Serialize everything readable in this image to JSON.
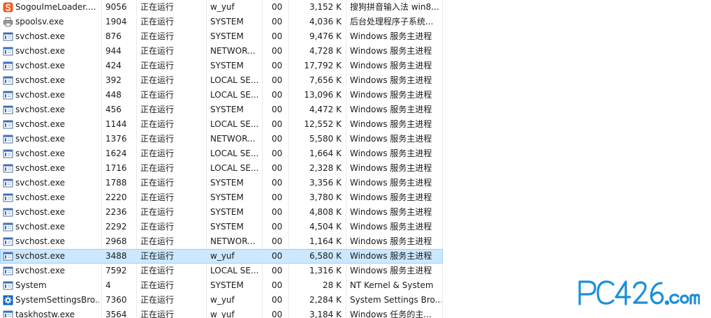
{
  "rows": [
    {
      "name": "SogouImeLoader....",
      "pid": "9056",
      "status": "正在运行",
      "user": "w_yuf",
      "cpu": "00",
      "mem": "3,152 K",
      "desc": "搜狗拼音输入法 win8...",
      "icon": "sogou-ime-icon",
      "selected": false
    },
    {
      "name": "spoolsv.exe",
      "pid": "1904",
      "status": "正在运行",
      "user": "SYSTEM",
      "cpu": "00",
      "mem": "4,036 K",
      "desc": "后台处理程序子系统...",
      "icon": "printer-icon",
      "selected": false
    },
    {
      "name": "svchost.exe",
      "pid": "876",
      "status": "正在运行",
      "user": "SYSTEM",
      "cpu": "00",
      "mem": "9,476 K",
      "desc": "Windows 服务主进程",
      "icon": "service-window-icon",
      "selected": false
    },
    {
      "name": "svchost.exe",
      "pid": "944",
      "status": "正在运行",
      "user": "NETWOR...",
      "cpu": "00",
      "mem": "4,728 K",
      "desc": "Windows 服务主进程",
      "icon": "service-window-icon",
      "selected": false
    },
    {
      "name": "svchost.exe",
      "pid": "424",
      "status": "正在运行",
      "user": "SYSTEM",
      "cpu": "00",
      "mem": "17,792 K",
      "desc": "Windows 服务主进程",
      "icon": "service-window-icon",
      "selected": false
    },
    {
      "name": "svchost.exe",
      "pid": "392",
      "status": "正在运行",
      "user": "LOCAL SE...",
      "cpu": "00",
      "mem": "7,656 K",
      "desc": "Windows 服务主进程",
      "icon": "service-window-icon",
      "selected": false
    },
    {
      "name": "svchost.exe",
      "pid": "448",
      "status": "正在运行",
      "user": "LOCAL SE...",
      "cpu": "00",
      "mem": "13,096 K",
      "desc": "Windows 服务主进程",
      "icon": "service-window-icon",
      "selected": false
    },
    {
      "name": "svchost.exe",
      "pid": "456",
      "status": "正在运行",
      "user": "SYSTEM",
      "cpu": "00",
      "mem": "4,472 K",
      "desc": "Windows 服务主进程",
      "icon": "service-window-icon",
      "selected": false
    },
    {
      "name": "svchost.exe",
      "pid": "1144",
      "status": "正在运行",
      "user": "LOCAL SE...",
      "cpu": "00",
      "mem": "12,552 K",
      "desc": "Windows 服务主进程",
      "icon": "service-window-icon",
      "selected": false
    },
    {
      "name": "svchost.exe",
      "pid": "1376",
      "status": "正在运行",
      "user": "NETWOR...",
      "cpu": "00",
      "mem": "5,580 K",
      "desc": "Windows 服务主进程",
      "icon": "service-window-icon",
      "selected": false
    },
    {
      "name": "svchost.exe",
      "pid": "1624",
      "status": "正在运行",
      "user": "LOCAL SE...",
      "cpu": "00",
      "mem": "1,664 K",
      "desc": "Windows 服务主进程",
      "icon": "service-window-icon",
      "selected": false
    },
    {
      "name": "svchost.exe",
      "pid": "1716",
      "status": "正在运行",
      "user": "LOCAL SE...",
      "cpu": "00",
      "mem": "2,328 K",
      "desc": "Windows 服务主进程",
      "icon": "service-window-icon",
      "selected": false
    },
    {
      "name": "svchost.exe",
      "pid": "1788",
      "status": "正在运行",
      "user": "SYSTEM",
      "cpu": "00",
      "mem": "3,356 K",
      "desc": "Windows 服务主进程",
      "icon": "service-window-icon",
      "selected": false
    },
    {
      "name": "svchost.exe",
      "pid": "2220",
      "status": "正在运行",
      "user": "SYSTEM",
      "cpu": "00",
      "mem": "3,780 K",
      "desc": "Windows 服务主进程",
      "icon": "service-window-icon",
      "selected": false
    },
    {
      "name": "svchost.exe",
      "pid": "2236",
      "status": "正在运行",
      "user": "SYSTEM",
      "cpu": "00",
      "mem": "4,808 K",
      "desc": "Windows 服务主进程",
      "icon": "service-window-icon",
      "selected": false
    },
    {
      "name": "svchost.exe",
      "pid": "2292",
      "status": "正在运行",
      "user": "SYSTEM",
      "cpu": "00",
      "mem": "4,504 K",
      "desc": "Windows 服务主进程",
      "icon": "service-window-icon",
      "selected": false
    },
    {
      "name": "svchost.exe",
      "pid": "2968",
      "status": "正在运行",
      "user": "NETWOR...",
      "cpu": "00",
      "mem": "1,164 K",
      "desc": "Windows 服务主进程",
      "icon": "service-window-icon",
      "selected": false
    },
    {
      "name": "svchost.exe",
      "pid": "3488",
      "status": "正在运行",
      "user": "w_yuf",
      "cpu": "00",
      "mem": "6,580 K",
      "desc": "Windows 服务主进程",
      "icon": "service-window-icon",
      "selected": true
    },
    {
      "name": "svchost.exe",
      "pid": "7592",
      "status": "正在运行",
      "user": "LOCAL SE...",
      "cpu": "00",
      "mem": "1,316 K",
      "desc": "Windows 服务主进程",
      "icon": "service-window-icon",
      "selected": false
    },
    {
      "name": "System",
      "pid": "4",
      "status": "正在运行",
      "user": "SYSTEM",
      "cpu": "00",
      "mem": "28 K",
      "desc": "NT Kernel & System",
      "icon": "service-window-icon",
      "selected": false
    },
    {
      "name": "SystemSettingsBro...",
      "pid": "7360",
      "status": "正在运行",
      "user": "w_yuf",
      "cpu": "00",
      "mem": "2,284 K",
      "desc": "System Settings Bro...",
      "icon": "settings-gear-icon",
      "selected": false
    },
    {
      "name": "taskhostw.exe",
      "pid": "3564",
      "status": "正在运行",
      "user": "w_yuf",
      "cpu": "00",
      "mem": "3,184 K",
      "desc": "Windows 任务的主...",
      "icon": "service-window-icon",
      "selected": false
    }
  ],
  "watermark": {
    "text": "PC426.com",
    "icon": "pc426-logo"
  },
  "colors": {
    "selected_bg": "#cce8ff",
    "selected_border": "#99d1ff",
    "logo_blue": "#1a8fd8",
    "sogou_orange": "#f05a22"
  }
}
